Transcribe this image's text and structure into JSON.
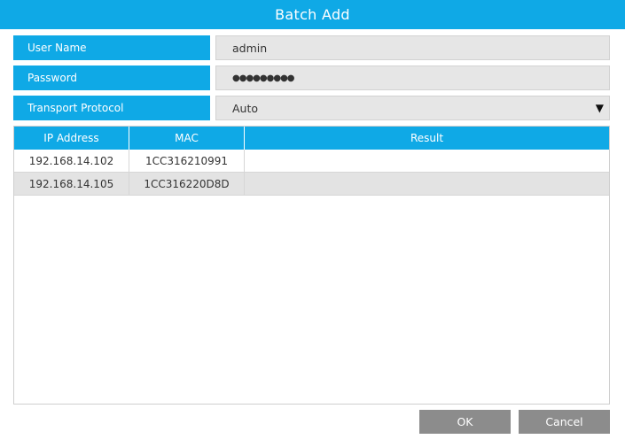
{
  "window": {
    "title": "Batch Add"
  },
  "form": {
    "username": {
      "label": "User Name",
      "value": "admin"
    },
    "password": {
      "label": "Password",
      "value": "●●●●●●●●●"
    },
    "transport_protocol": {
      "label": "Transport Protocol",
      "value": "Auto"
    }
  },
  "table": {
    "headers": {
      "ip": "IP Address",
      "mac": "MAC",
      "result": "Result"
    },
    "rows": [
      {
        "ip": "192.168.14.102",
        "mac": "1CC316210991",
        "result": ""
      },
      {
        "ip": "192.168.14.105",
        "mac": "1CC316220D8D",
        "result": ""
      }
    ]
  },
  "buttons": {
    "ok": "OK",
    "cancel": "Cancel"
  },
  "colors": {
    "accent": "#0fa9e6",
    "button": "#8c8c8c",
    "alt_row": "#e3e3e3"
  }
}
